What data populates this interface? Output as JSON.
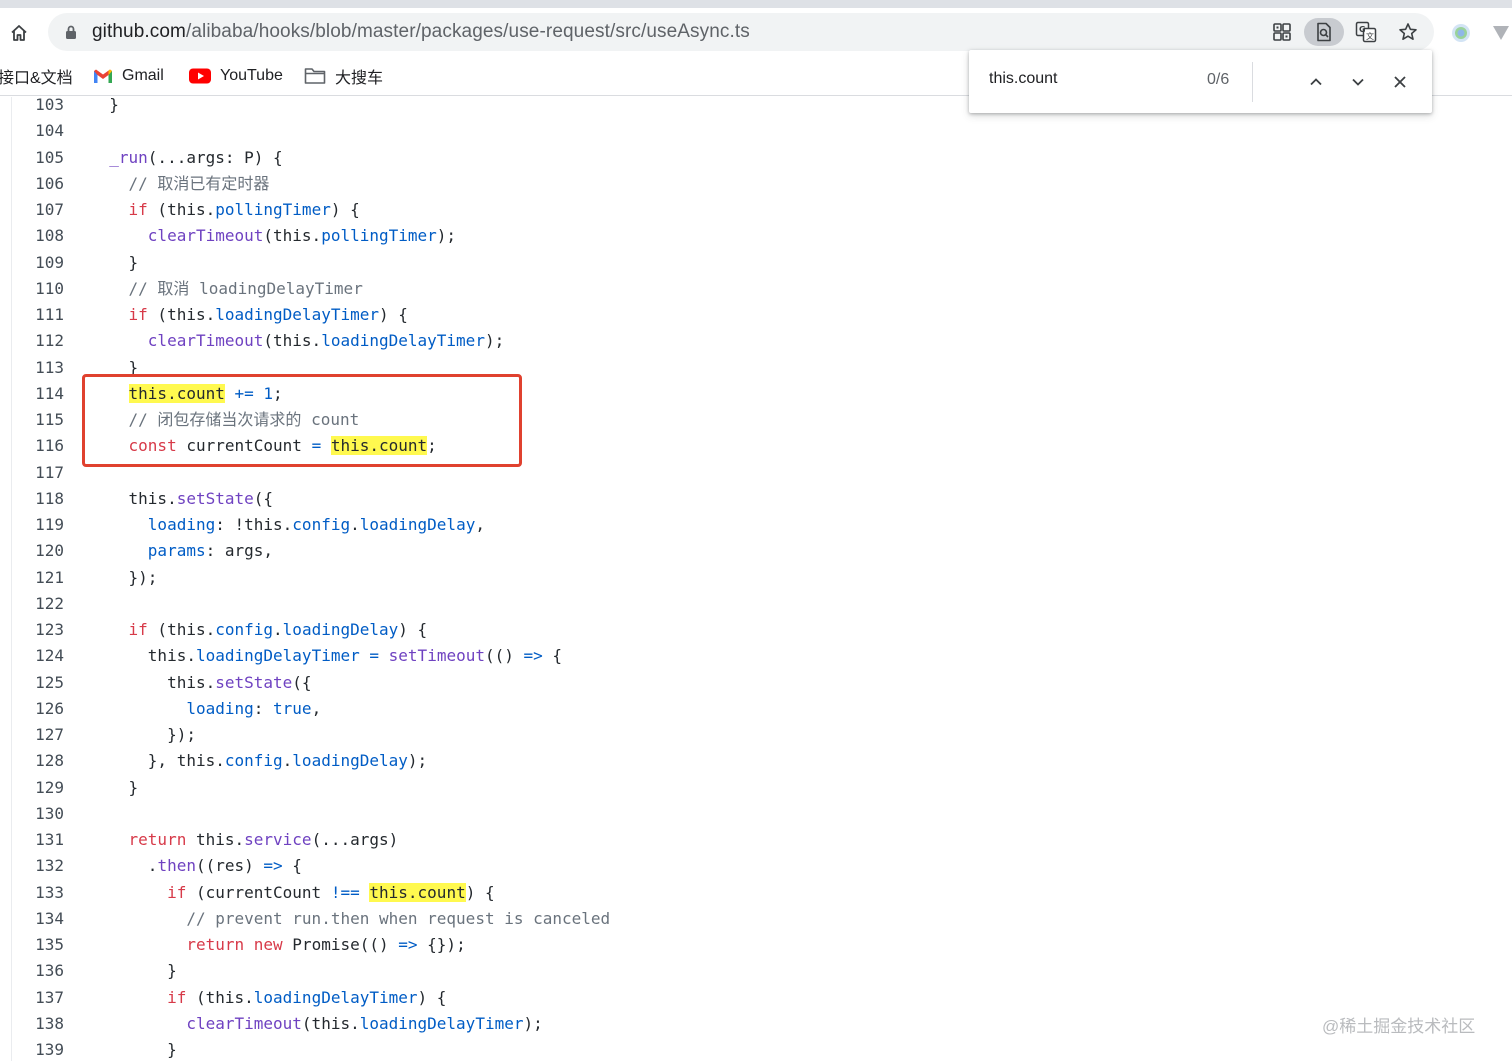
{
  "browser": {
    "url": {
      "host": "github.com",
      "path": "/alibaba/hooks/blob/master/packages/use-request/src/useAsync.ts"
    },
    "icons": [
      "home-icon",
      "lock-icon",
      "apps-grid-icon",
      "find-in-page-icon",
      "translate-icon",
      "star-icon",
      "extension-icon",
      "menu-icon"
    ]
  },
  "bookmarks": [
    {
      "label": "接口&文档",
      "icon": "none"
    },
    {
      "label": "Gmail",
      "icon": "gmail-icon"
    },
    {
      "label": "YouTube",
      "icon": "youtube-icon"
    },
    {
      "label": "大搜车",
      "icon": "folder-icon"
    }
  ],
  "findbar": {
    "query": "this.count",
    "count": "0/6"
  },
  "code": {
    "lines": [
      {
        "n": "103",
        "tokens": [
          {
            "t": "  }",
            "c": "plain"
          }
        ]
      },
      {
        "n": "104",
        "tokens": []
      },
      {
        "n": "105",
        "tokens": [
          {
            "t": "  ",
            "c": "plain"
          },
          {
            "t": "_run",
            "c": "fn"
          },
          {
            "t": "(...args: P) {",
            "c": "plain"
          }
        ]
      },
      {
        "n": "106",
        "tokens": [
          {
            "t": "    // 取消已有定时器",
            "c": "com"
          }
        ]
      },
      {
        "n": "107",
        "tokens": [
          {
            "t": "    ",
            "c": "plain"
          },
          {
            "t": "if",
            "c": "kw"
          },
          {
            "t": " (this.",
            "c": "plain"
          },
          {
            "t": "pollingTimer",
            "c": "prop"
          },
          {
            "t": ") {",
            "c": "plain"
          }
        ]
      },
      {
        "n": "108",
        "tokens": [
          {
            "t": "      ",
            "c": "plain"
          },
          {
            "t": "clearTimeout",
            "c": "fn"
          },
          {
            "t": "(this.",
            "c": "plain"
          },
          {
            "t": "pollingTimer",
            "c": "prop"
          },
          {
            "t": ");",
            "c": "plain"
          }
        ]
      },
      {
        "n": "109",
        "tokens": [
          {
            "t": "    }",
            "c": "plain"
          }
        ]
      },
      {
        "n": "110",
        "tokens": [
          {
            "t": "    // 取消 loadingDelayTimer",
            "c": "com"
          }
        ]
      },
      {
        "n": "111",
        "tokens": [
          {
            "t": "    ",
            "c": "plain"
          },
          {
            "t": "if",
            "c": "kw"
          },
          {
            "t": " (this.",
            "c": "plain"
          },
          {
            "t": "loadingDelayTimer",
            "c": "prop"
          },
          {
            "t": ") {",
            "c": "plain"
          }
        ]
      },
      {
        "n": "112",
        "tokens": [
          {
            "t": "      ",
            "c": "plain"
          },
          {
            "t": "clearTimeout",
            "c": "fn"
          },
          {
            "t": "(this.",
            "c": "plain"
          },
          {
            "t": "loadingDelayTimer",
            "c": "prop"
          },
          {
            "t": ");",
            "c": "plain"
          }
        ]
      },
      {
        "n": "113",
        "tokens": [
          {
            "t": "    }",
            "c": "plain"
          }
        ]
      },
      {
        "n": "114",
        "tokens": [
          {
            "t": "    ",
            "c": "plain"
          },
          {
            "t": "this.count",
            "c": "hl"
          },
          {
            "t": " ",
            "c": "plain"
          },
          {
            "t": "+=",
            "c": "prop"
          },
          {
            "t": " ",
            "c": "plain"
          },
          {
            "t": "1",
            "c": "prop"
          },
          {
            "t": ";",
            "c": "plain"
          }
        ]
      },
      {
        "n": "115",
        "tokens": [
          {
            "t": "    // 闭包存储当次请求的 count",
            "c": "com"
          }
        ]
      },
      {
        "n": "116",
        "tokens": [
          {
            "t": "    ",
            "c": "plain"
          },
          {
            "t": "const",
            "c": "kw"
          },
          {
            "t": " currentCount ",
            "c": "plain"
          },
          {
            "t": "=",
            "c": "prop"
          },
          {
            "t": " ",
            "c": "plain"
          },
          {
            "t": "this.count",
            "c": "hl"
          },
          {
            "t": ";",
            "c": "plain"
          }
        ]
      },
      {
        "n": "117",
        "tokens": []
      },
      {
        "n": "118",
        "tokens": [
          {
            "t": "    this.",
            "c": "plain"
          },
          {
            "t": "setState",
            "c": "fn"
          },
          {
            "t": "({",
            "c": "plain"
          }
        ]
      },
      {
        "n": "119",
        "tokens": [
          {
            "t": "      ",
            "c": "plain"
          },
          {
            "t": "loading",
            "c": "prop"
          },
          {
            "t": ": !this.",
            "c": "plain"
          },
          {
            "t": "config",
            "c": "prop"
          },
          {
            "t": ".",
            "c": "plain"
          },
          {
            "t": "loadingDelay",
            "c": "prop"
          },
          {
            "t": ",",
            "c": "plain"
          }
        ]
      },
      {
        "n": "120",
        "tokens": [
          {
            "t": "      ",
            "c": "plain"
          },
          {
            "t": "params",
            "c": "prop"
          },
          {
            "t": ": args,",
            "c": "plain"
          }
        ]
      },
      {
        "n": "121",
        "tokens": [
          {
            "t": "    });",
            "c": "plain"
          }
        ]
      },
      {
        "n": "122",
        "tokens": []
      },
      {
        "n": "123",
        "tokens": [
          {
            "t": "    ",
            "c": "plain"
          },
          {
            "t": "if",
            "c": "kw"
          },
          {
            "t": " (this.",
            "c": "plain"
          },
          {
            "t": "config",
            "c": "prop"
          },
          {
            "t": ".",
            "c": "plain"
          },
          {
            "t": "loadingDelay",
            "c": "prop"
          },
          {
            "t": ") {",
            "c": "plain"
          }
        ]
      },
      {
        "n": "124",
        "tokens": [
          {
            "t": "      this.",
            "c": "plain"
          },
          {
            "t": "loadingDelayTimer",
            "c": "prop"
          },
          {
            "t": " ",
            "c": "plain"
          },
          {
            "t": "=",
            "c": "prop"
          },
          {
            "t": " ",
            "c": "plain"
          },
          {
            "t": "setTimeout",
            "c": "fn"
          },
          {
            "t": "(() ",
            "c": "plain"
          },
          {
            "t": "=>",
            "c": "prop"
          },
          {
            "t": " {",
            "c": "plain"
          }
        ]
      },
      {
        "n": "125",
        "tokens": [
          {
            "t": "        this.",
            "c": "plain"
          },
          {
            "t": "setState",
            "c": "fn"
          },
          {
            "t": "({",
            "c": "plain"
          }
        ]
      },
      {
        "n": "126",
        "tokens": [
          {
            "t": "          ",
            "c": "plain"
          },
          {
            "t": "loading",
            "c": "prop"
          },
          {
            "t": ": ",
            "c": "plain"
          },
          {
            "t": "true",
            "c": "prop"
          },
          {
            "t": ",",
            "c": "plain"
          }
        ]
      },
      {
        "n": "127",
        "tokens": [
          {
            "t": "        });",
            "c": "plain"
          }
        ]
      },
      {
        "n": "128",
        "tokens": [
          {
            "t": "      }, this.",
            "c": "plain"
          },
          {
            "t": "config",
            "c": "prop"
          },
          {
            "t": ".",
            "c": "plain"
          },
          {
            "t": "loadingDelay",
            "c": "prop"
          },
          {
            "t": ");",
            "c": "plain"
          }
        ]
      },
      {
        "n": "129",
        "tokens": [
          {
            "t": "    }",
            "c": "plain"
          }
        ]
      },
      {
        "n": "130",
        "tokens": []
      },
      {
        "n": "131",
        "tokens": [
          {
            "t": "    ",
            "c": "plain"
          },
          {
            "t": "return",
            "c": "kw"
          },
          {
            "t": " this.",
            "c": "plain"
          },
          {
            "t": "service",
            "c": "fn"
          },
          {
            "t": "(...args)",
            "c": "plain"
          }
        ]
      },
      {
        "n": "132",
        "tokens": [
          {
            "t": "      .",
            "c": "plain"
          },
          {
            "t": "then",
            "c": "fn"
          },
          {
            "t": "((res) ",
            "c": "plain"
          },
          {
            "t": "=>",
            "c": "prop"
          },
          {
            "t": " {",
            "c": "plain"
          }
        ]
      },
      {
        "n": "133",
        "tokens": [
          {
            "t": "        ",
            "c": "plain"
          },
          {
            "t": "if",
            "c": "kw"
          },
          {
            "t": " (currentCount ",
            "c": "plain"
          },
          {
            "t": "!==",
            "c": "prop"
          },
          {
            "t": " ",
            "c": "plain"
          },
          {
            "t": "this.count",
            "c": "hl"
          },
          {
            "t": ") {",
            "c": "plain"
          }
        ]
      },
      {
        "n": "134",
        "tokens": [
          {
            "t": "          // prevent run.then when request is canceled",
            "c": "com"
          }
        ]
      },
      {
        "n": "135",
        "tokens": [
          {
            "t": "          ",
            "c": "plain"
          },
          {
            "t": "return",
            "c": "kw"
          },
          {
            "t": " ",
            "c": "plain"
          },
          {
            "t": "new",
            "c": "kw"
          },
          {
            "t": " Promise(() ",
            "c": "plain"
          },
          {
            "t": "=>",
            "c": "prop"
          },
          {
            "t": " {});",
            "c": "plain"
          }
        ]
      },
      {
        "n": "136",
        "tokens": [
          {
            "t": "        }",
            "c": "plain"
          }
        ]
      },
      {
        "n": "137",
        "tokens": [
          {
            "t": "        ",
            "c": "plain"
          },
          {
            "t": "if",
            "c": "kw"
          },
          {
            "t": " (this.",
            "c": "plain"
          },
          {
            "t": "loadingDelayTimer",
            "c": "prop"
          },
          {
            "t": ") {",
            "c": "plain"
          }
        ]
      },
      {
        "n": "138",
        "tokens": [
          {
            "t": "          ",
            "c": "plain"
          },
          {
            "t": "clearTimeout",
            "c": "fn"
          },
          {
            "t": "(this.",
            "c": "plain"
          },
          {
            "t": "loadingDelayTimer",
            "c": "prop"
          },
          {
            "t": ");",
            "c": "plain"
          }
        ]
      },
      {
        "n": "139",
        "tokens": [
          {
            "t": "        }",
            "c": "plain"
          }
        ]
      }
    ]
  },
  "watermark": "@稀土掘金技术社区",
  "colors": {
    "keyword": "#d73a49",
    "function": "#6f42c1",
    "property": "#005cc5",
    "comment": "#6a737d",
    "highlight": "#fff94f",
    "annotation": "#e0412f"
  }
}
